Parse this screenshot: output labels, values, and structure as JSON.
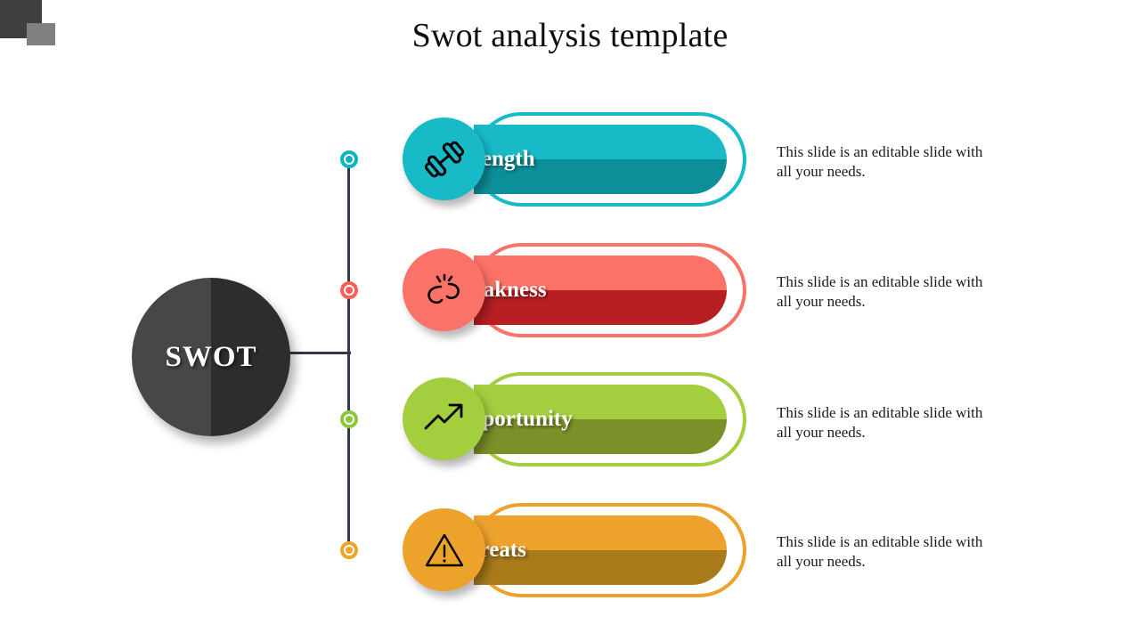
{
  "slide": {
    "title": "Swot analysis template",
    "hub_label": "SWOT"
  },
  "decor": {
    "square_dark_color": "#3f3f3f",
    "square_light_color": "#808080",
    "connector_color": "#33384d",
    "hub_left_color": "#474747",
    "hub_right_color": "#2d2d2d"
  },
  "rows": [
    {
      "label": "Strength",
      "description": "This slide is an editable slide with all your needs.",
      "icon": "dumbbell-icon",
      "accent": "#16bcc8",
      "fill_top": "#17bac6",
      "fill_bottom": "#0d8f9a",
      "dot_color": "#0cb3c0"
    },
    {
      "label": "Weakness",
      "description": "This slide is an editable slide with all your needs.",
      "icon": "broken-chain-icon",
      "accent": "#fb7268",
      "fill_top": "#fa7268",
      "fill_bottom": "#b81f22",
      "dot_color": "#fb5f5a"
    },
    {
      "label": "Opportunity",
      "description": "This slide is an editable slide with all your needs.",
      "icon": "trend-up-arrow-icon",
      "accent": "#a3cf3e",
      "fill_top": "#a3cf3e",
      "fill_bottom": "#7a9028",
      "dot_color": "#8cc63f"
    },
    {
      "label": "Threats",
      "description": "This slide is an editable slide with all your needs.",
      "icon": "warning-triangle-icon",
      "accent": "#eda22c",
      "fill_top": "#eda22c",
      "fill_bottom": "#a87a1a",
      "dot_color": "#efa42e"
    }
  ]
}
